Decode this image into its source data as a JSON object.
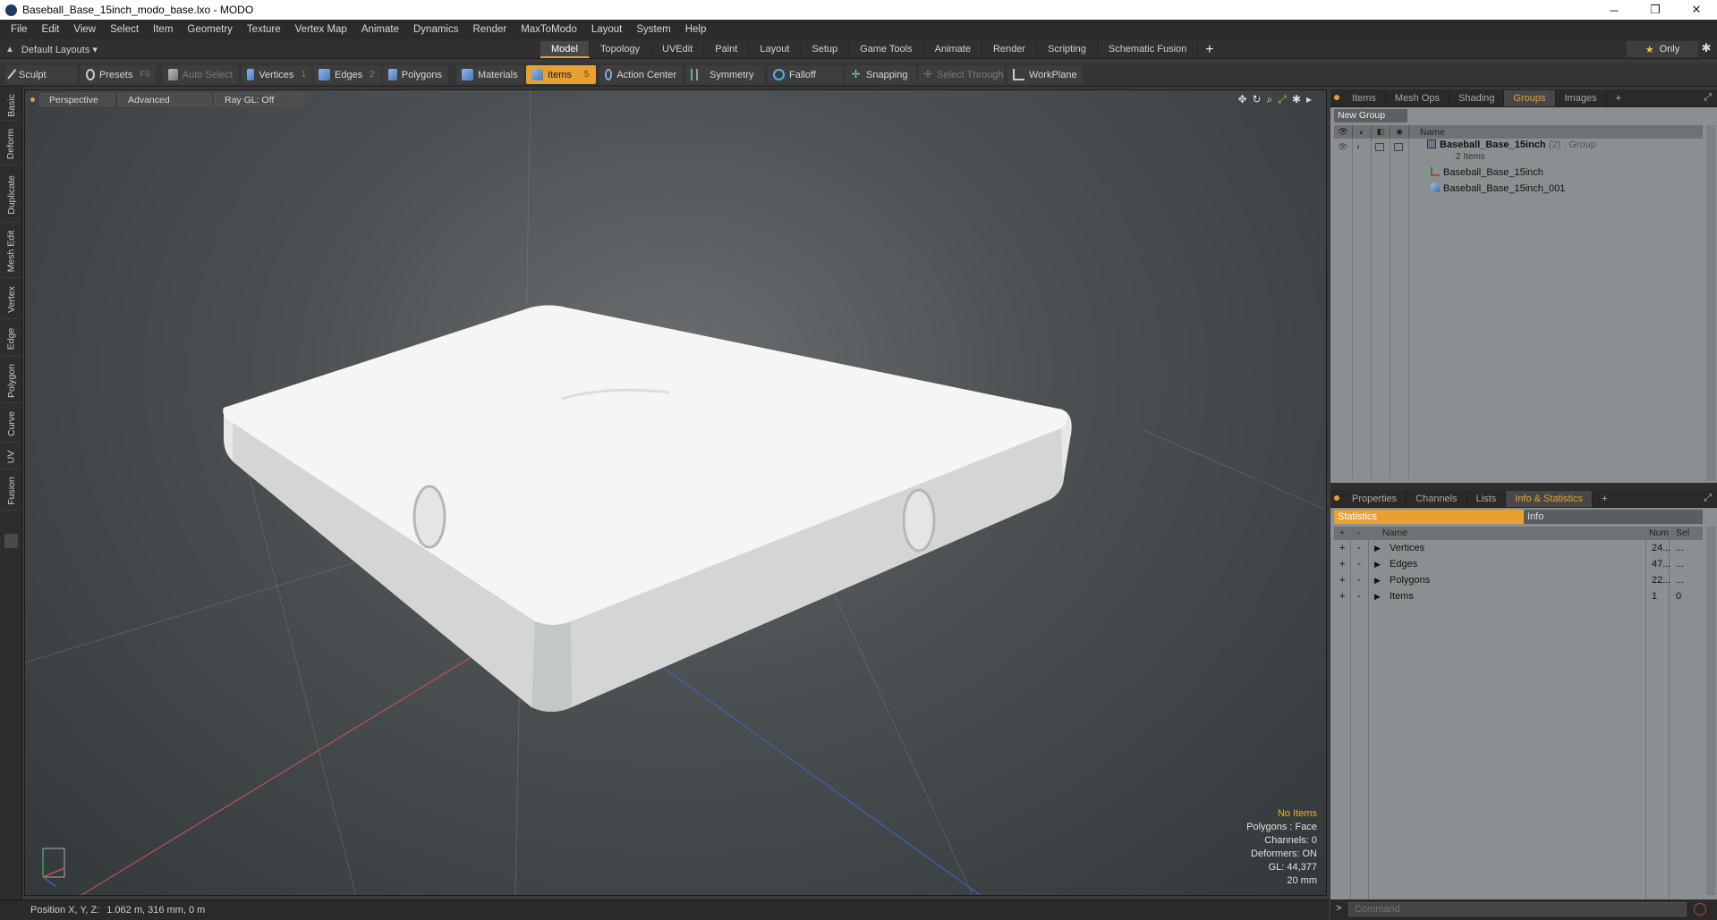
{
  "window": {
    "title": "Baseball_Base_15inch_modo_base.lxo - MODO",
    "min": "─",
    "max": "❐",
    "close": "✕"
  },
  "menu": [
    "File",
    "Edit",
    "View",
    "Select",
    "Item",
    "Geometry",
    "Texture",
    "Vertex Map",
    "Animate",
    "Dynamics",
    "Render",
    "MaxToModo",
    "Layout",
    "System",
    "Help"
  ],
  "layouts": {
    "label": "Default Layouts ▾",
    "tabs": [
      "Model",
      "Topology",
      "UVEdit",
      "Paint",
      "Layout",
      "Setup",
      "Game Tools",
      "Animate",
      "Render",
      "Scripting",
      "Schematic Fusion"
    ],
    "active_tab": "Model",
    "plus": "+",
    "only": "Only",
    "star": "★",
    "gear": "✱"
  },
  "toolbar": {
    "sculpt": "Sculpt",
    "presets": "Presets",
    "presets_key": "F6",
    "auto_select": "Auto Select",
    "vertices": "Vertices",
    "vertices_key": "1",
    "edges": "Edges",
    "edges_key": "2",
    "polygons": "Polygons",
    "materials": "Materials",
    "items": "Items",
    "items_key": "5",
    "action_center": "Action Center",
    "symmetry": "Symmetry",
    "falloff": "Falloff",
    "snapping": "Snapping",
    "select_through": "Select Through",
    "workplane": "WorkPlane"
  },
  "left_tabs": [
    "Basic",
    "Deform",
    "Duplicate",
    "Mesh Edit",
    "Vertex",
    "Edge",
    "Polygon",
    "Curve",
    "UV",
    "Fusion"
  ],
  "viewport": {
    "view": "Perspective",
    "mode": "Advanced",
    "raygl": "Ray GL: Off",
    "info": {
      "items": "No Items",
      "polygons": "Polygons : Face",
      "channels": "Channels: 0",
      "deformers": "Deformers: ON",
      "gl": "GL: 44,377",
      "scale": "20 mm"
    }
  },
  "status": {
    "label": "Position X, Y, Z:",
    "value": "1.062 m, 316 mm, 0 m"
  },
  "groups_panel": {
    "tabs": [
      "Items",
      "Mesh Ops",
      "Shading",
      "Groups",
      "Images"
    ],
    "active": "Groups",
    "plus": "+",
    "new_group": "New Group",
    "header_name": "Name",
    "group_name": "Baseball_Base_15inch",
    "group_count": "(2)",
    "group_type": ": Group",
    "group_items": "2 Items",
    "children": [
      "Baseball_Base_15inch",
      "Baseball_Base_15inch_001"
    ]
  },
  "stats_panel": {
    "tabs": [
      "Properties",
      "Channels",
      "Lists",
      "Info & Statistics"
    ],
    "active": "Info & Statistics",
    "plus": "+",
    "subtabs": [
      "Statistics",
      "Info"
    ],
    "headers": {
      "name": "Name",
      "num": "Num",
      "sel": "Sel"
    },
    "rows": [
      {
        "name": "Vertices",
        "num": "24...",
        "sel": "..."
      },
      {
        "name": "Edges",
        "num": "47...",
        "sel": "..."
      },
      {
        "name": "Polygons",
        "num": "22...",
        "sel": "..."
      },
      {
        "name": "Items",
        "num": "1",
        "sel": "0"
      }
    ]
  },
  "command": {
    "placeholder": "Command",
    "prompt": ">"
  }
}
